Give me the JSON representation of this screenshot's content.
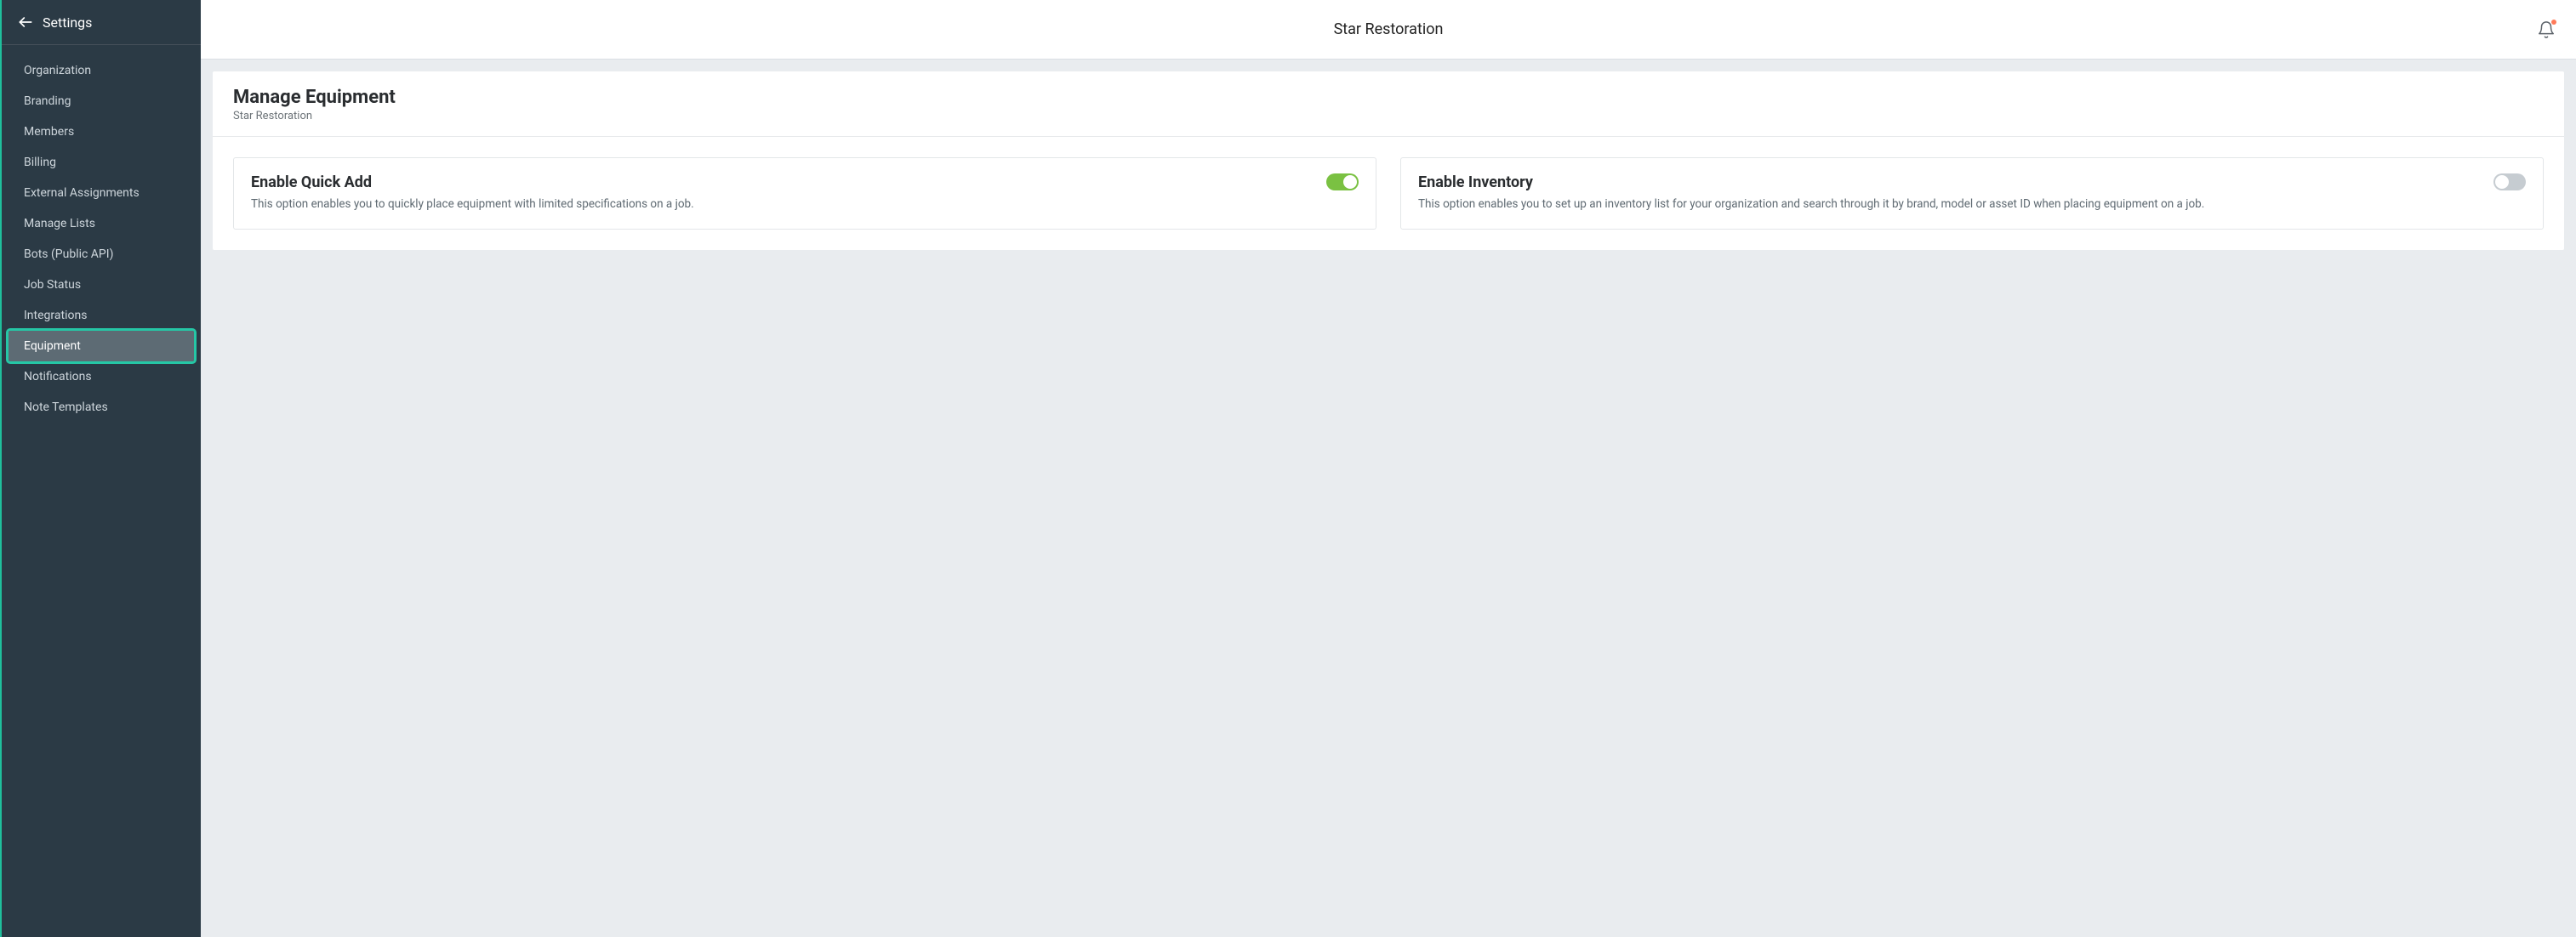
{
  "sidebar": {
    "title": "Settings",
    "items": [
      {
        "label": "Organization",
        "selected": false
      },
      {
        "label": "Branding",
        "selected": false
      },
      {
        "label": "Members",
        "selected": false
      },
      {
        "label": "Billing",
        "selected": false
      },
      {
        "label": "External Assignments",
        "selected": false
      },
      {
        "label": "Manage Lists",
        "selected": false
      },
      {
        "label": "Bots (Public API)",
        "selected": false
      },
      {
        "label": "Job Status",
        "selected": false
      },
      {
        "label": "Integrations",
        "selected": false
      },
      {
        "label": "Equipment",
        "selected": true
      },
      {
        "label": "Notifications",
        "selected": false
      },
      {
        "label": "Note Templates",
        "selected": false
      }
    ]
  },
  "header": {
    "title": "Star Restoration",
    "notification_has_badge": true
  },
  "page": {
    "title": "Manage Equipment",
    "subtitle": "Star Restoration",
    "settings": [
      {
        "title": "Enable Quick Add",
        "description": "This option enables you to quickly place equipment with limited specifications on a job.",
        "enabled": true
      },
      {
        "title": "Enable Inventory",
        "description": "This option enables you to set up an inventory list for your organization and search through it by brand, model or asset ID when placing equipment on a job.",
        "enabled": false
      }
    ]
  }
}
